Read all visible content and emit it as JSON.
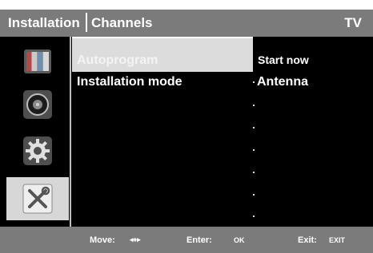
{
  "header": {
    "section": "Installation",
    "title": "Channels",
    "source": "TV"
  },
  "sidebar": {
    "items": [
      {
        "icon": "picture-icon"
      },
      {
        "icon": "sound-icon"
      },
      {
        "icon": "settings-icon"
      },
      {
        "icon": "installation-tools-icon",
        "selected": true
      }
    ]
  },
  "menu": {
    "items": [
      {
        "label": "Autoprogram",
        "value": "Start now"
      },
      {
        "label": "Installation mode",
        "value": "Antenna"
      }
    ]
  },
  "footer": {
    "move_label": "Move:",
    "move_icon": "◂♦▸",
    "enter_label": "Enter:",
    "enter_key": "OK",
    "exit_label": "Exit:",
    "exit_key": "EXIT"
  },
  "colors": {
    "bar": "#7b7b7b",
    "background": "#000000",
    "highlight": "#dcdcdc",
    "text": "#ffffff"
  }
}
